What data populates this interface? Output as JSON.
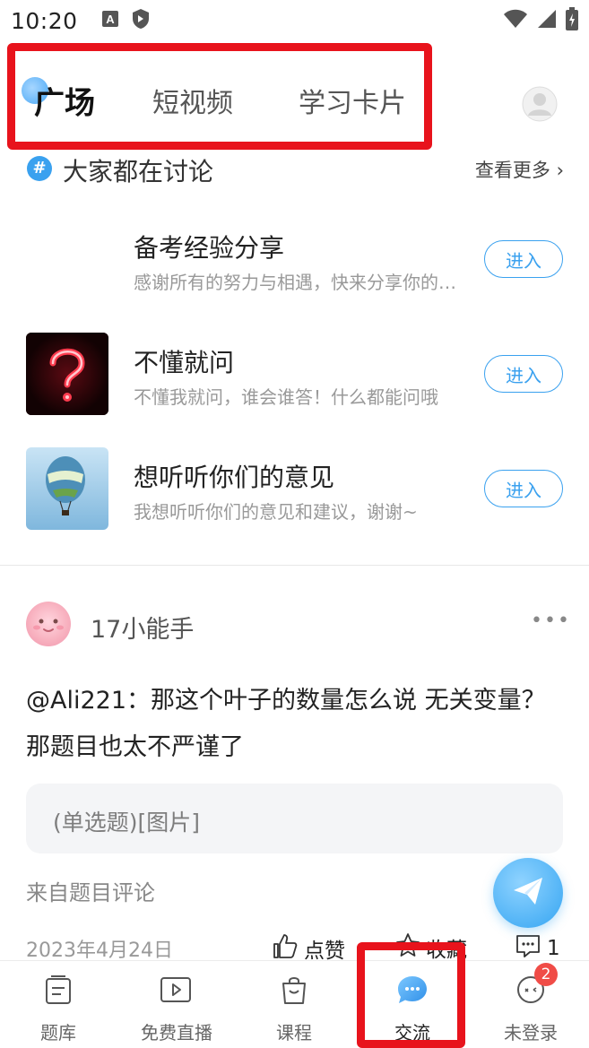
{
  "status_bar": {
    "time": "10:20",
    "left_icons": [
      "text-a-icon",
      "shield-icon"
    ],
    "right_icons": [
      "wifi-icon",
      "signal-icon",
      "battery-icon"
    ]
  },
  "top_tabs": {
    "items": [
      {
        "label": "广场",
        "active": true
      },
      {
        "label": "短视频",
        "active": false
      },
      {
        "label": "学习卡片",
        "active": false
      }
    ],
    "profile_icon": "user-avatar-icon"
  },
  "discussion": {
    "title": "大家都在讨论",
    "see_more": "查看更多",
    "topics": [
      {
        "title": "备考经验分享",
        "desc": "感谢所有的努力与相遇，快来分享你的备考经验吧",
        "enter": "进入",
        "thumb": "blank"
      },
      {
        "title": "不懂就问",
        "desc": "不懂我就问，谁会谁答！什么都能问哦",
        "enter": "进入",
        "thumb": "neon-question-mark"
      },
      {
        "title": "想听听你们的意见",
        "desc": "我想听听你们的意见和建议，谢谢~",
        "enter": "进入",
        "thumb": "hot-air-balloon"
      }
    ]
  },
  "post": {
    "username": "17小能手",
    "more": "•••",
    "content": "@Ali221：那这个叶子的数量怎么说 无关变量？那题目也太不严谨了",
    "quote": "(单选题)[图片]",
    "source": "来自题目评论",
    "date": "2023年4月24日",
    "like_label": "点赞",
    "favorite_label": "收藏",
    "comment_count": "1"
  },
  "bottom_nav": {
    "items": [
      {
        "label": "题库",
        "icon": "question-bank-icon",
        "active": false
      },
      {
        "label": "免费直播",
        "icon": "live-video-icon",
        "active": false
      },
      {
        "label": "课程",
        "icon": "course-bag-icon",
        "active": false
      },
      {
        "label": "交流",
        "icon": "chat-bubble-icon",
        "active": true
      },
      {
        "label": "未登录",
        "icon": "guest-avatar-icon",
        "active": false,
        "badge": "2"
      }
    ]
  },
  "colors": {
    "accent": "#3aa1ef",
    "highlight_box": "#e8131c",
    "badge": "#f04c47"
  }
}
